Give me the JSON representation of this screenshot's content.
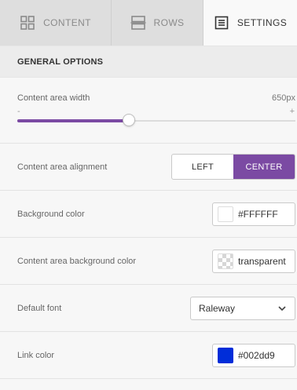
{
  "tabs": [
    {
      "label": "CONTENT",
      "icon": "grid-icon",
      "active": false
    },
    {
      "label": "ROWS",
      "icon": "rows-icon",
      "active": false
    },
    {
      "label": "SETTINGS",
      "icon": "settings-doc-icon",
      "active": true
    }
  ],
  "section": {
    "title": "GENERAL OPTIONS"
  },
  "width_setting": {
    "label": "Content area width",
    "value": "650px",
    "minus": "-",
    "plus": "+",
    "fraction": 0.4
  },
  "alignment": {
    "label": "Content area alignment",
    "options": [
      "LEFT",
      "CENTER"
    ],
    "selected": "CENTER"
  },
  "background_color": {
    "label": "Background color",
    "value": "#FFFFFF",
    "swatch": "#FFFFFF"
  },
  "content_bg_color": {
    "label": "Content area background color",
    "value": "transparent",
    "swatch": "transparent"
  },
  "default_font": {
    "label": "Default font",
    "value": "Raleway"
  },
  "link_color": {
    "label": "Link color",
    "value": "#002dd9",
    "swatch": "#002dd9"
  },
  "colors": {
    "accent": "#7b4aa3"
  }
}
